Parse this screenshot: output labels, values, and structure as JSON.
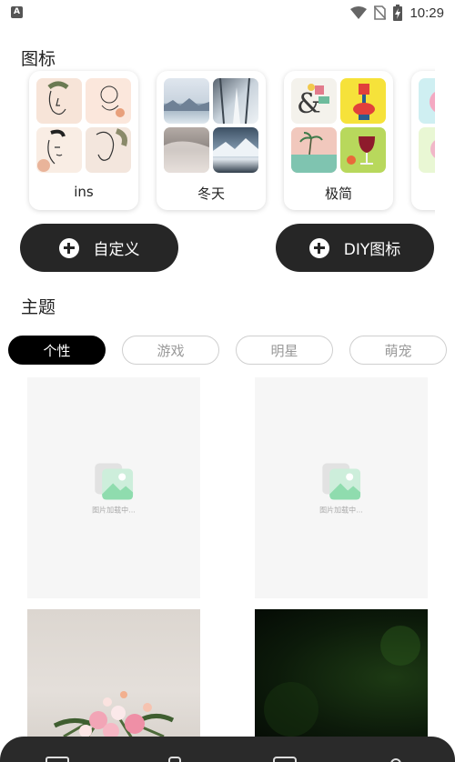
{
  "status_bar": {
    "app_badge": "A",
    "time": "10:29",
    "icons": [
      "wifi-icon",
      "no-sim-icon",
      "battery-charging-icon"
    ]
  },
  "icons_section": {
    "title": "图标",
    "packs": [
      {
        "label": "ins"
      },
      {
        "label": "冬天"
      },
      {
        "label": "极简"
      },
      {
        "label": ""
      }
    ]
  },
  "actions": {
    "custom_label": "自定义",
    "diy_label": "DIY图标"
  },
  "themes_section": {
    "title": "主题",
    "categories": [
      {
        "label": "个性",
        "active": true
      },
      {
        "label": "游戏",
        "active": false
      },
      {
        "label": "明星",
        "active": false
      },
      {
        "label": "萌宠",
        "active": false
      }
    ],
    "loading_text": "图片加载中..."
  },
  "bottom_nav": {
    "icons": [
      "home-icon",
      "theme-icon",
      "widget-icon",
      "profile-icon"
    ]
  },
  "colors": {
    "button_dark": "#262626",
    "chip_active": "#000000",
    "placeholder_bg": "#f6f6f6"
  }
}
